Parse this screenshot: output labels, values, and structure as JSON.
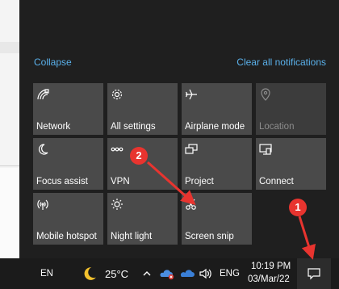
{
  "header": {
    "collapse_label": "Collapse",
    "clear_label": "Clear all notifications"
  },
  "tiles": [
    {
      "label": "Network",
      "icon": "network-icon"
    },
    {
      "label": "All settings",
      "icon": "gear-icon"
    },
    {
      "label": "Airplane mode",
      "icon": "airplane-icon"
    },
    {
      "label": "Location",
      "icon": "location-icon"
    },
    {
      "label": "Focus assist",
      "icon": "moon-icon"
    },
    {
      "label": "VPN",
      "icon": "vpn-icon"
    },
    {
      "label": "Project",
      "icon": "project-icon"
    },
    {
      "label": "Connect",
      "icon": "connect-icon"
    },
    {
      "label": "Mobile hotspot",
      "icon": "hotspot-icon"
    },
    {
      "label": "Night light",
      "icon": "sun-icon"
    },
    {
      "label": "Screen snip",
      "icon": "scissors-icon"
    }
  ],
  "taskbar": {
    "lang": "EN",
    "temperature": "25°C",
    "input_lang": "ENG",
    "time": "10:19 PM",
    "date": "03/Mar/22"
  },
  "annotations": {
    "badge1": "1",
    "badge2": "2",
    "color": "#e8342f"
  }
}
